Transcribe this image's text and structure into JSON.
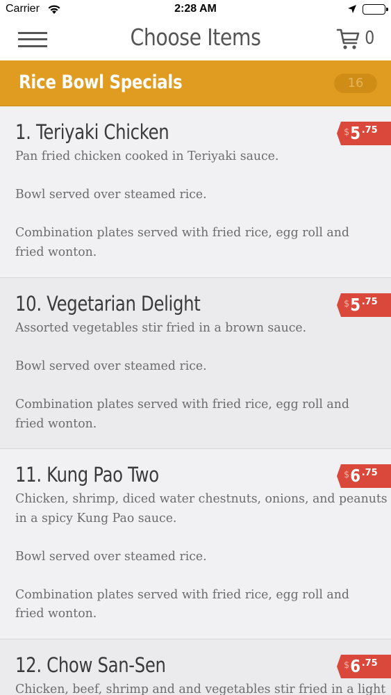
{
  "status_bar": {
    "carrier": "Carrier",
    "time": "2:28 AM",
    "icons": [
      "wifi-icon",
      "location-arrow-icon",
      "battery-icon"
    ]
  },
  "nav": {
    "title": "Choose Items",
    "cart_count": "0",
    "icons": [
      "hamburger-menu-icon",
      "shopping-cart-icon"
    ]
  },
  "category": {
    "title": "Rice Bowl Specials",
    "count": "16"
  },
  "colors": {
    "accent": "#e09c21",
    "price_tag": "#d9483a",
    "header_bg": "#ffffff"
  },
  "items": [
    {
      "name": "1. Teriyaki Chicken",
      "currency": "$",
      "price_main": "5",
      "price_cents": ".75",
      "desc": [
        "Pan fried chicken cooked in Teriyaki sauce.",
        "",
        "Bowl served over steamed rice.",
        "",
        "Combination plates served with fried rice, egg roll and",
        "fried wonton."
      ]
    },
    {
      "name": "10. Vegetarian Delight",
      "currency": "$",
      "price_main": "5",
      "price_cents": ".75",
      "desc": [
        "Assorted vegetables stir fried in a brown sauce.",
        "",
        "Bowl served over steamed rice.",
        "",
        "Combination plates served with fried rice, egg roll and",
        "fried wonton."
      ]
    },
    {
      "name": "11. Kung Pao Two",
      "currency": "$",
      "price_main": "6",
      "price_cents": ".75",
      "desc": [
        "Chicken, shrimp, diced water chestnuts, onions, and peanuts",
        "in a spicy Kung Pao sauce.",
        "",
        "Bowl served over steamed rice.",
        "",
        "Combination plates served with fried rice, egg roll and",
        "fried wonton."
      ]
    },
    {
      "name": "12. Chow San-Sen",
      "currency": "$",
      "price_main": "6",
      "price_cents": ".75",
      "desc": [
        "Chicken, beef, shrimp and and vegetables stir fried in a light"
      ]
    }
  ]
}
